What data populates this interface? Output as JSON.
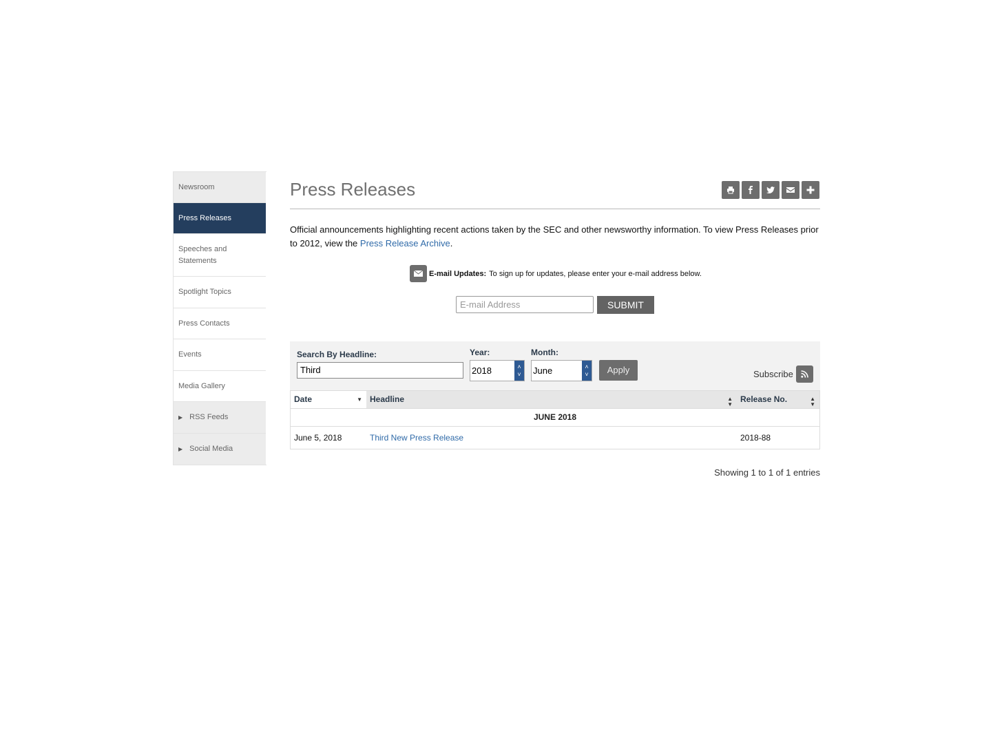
{
  "sidebar": {
    "items": [
      {
        "label": "Newsroom"
      },
      {
        "label": "Press Releases"
      },
      {
        "label": "Speeches and Statements"
      },
      {
        "label": "Spotlight Topics"
      },
      {
        "label": "Press Contacts"
      },
      {
        "label": "Events"
      },
      {
        "label": "Media Gallery"
      },
      {
        "label": "RSS Feeds"
      },
      {
        "label": "Social Media"
      }
    ]
  },
  "page": {
    "title": "Press Releases",
    "share_icons": [
      "print-icon",
      "facebook-icon",
      "twitter-icon",
      "envelope-icon",
      "plus-icon"
    ]
  },
  "intro": {
    "text_before": "Official announcements highlighting recent actions taken by the SEC and other newsworthy information.  To view Press Releases prior to 2012, view the ",
    "link": "Press Release Archive",
    "text_after": "."
  },
  "email_updates": {
    "label": "E-mail Updates:",
    "text": "To sign up for updates, please enter your e-mail address below.",
    "placeholder": "E-mail Address",
    "submit": "SUBMIT"
  },
  "filters": {
    "headline_label": "Search By Headline:",
    "headline_value": "Third",
    "year_label": "Year:",
    "year_value": "2018",
    "month_label": "Month:",
    "month_value": "June",
    "apply": "Apply",
    "subscribe": "Subscribe"
  },
  "table": {
    "columns": [
      "Date",
      "Headline",
      "Release No."
    ],
    "group": "JUNE 2018",
    "rows": [
      {
        "date": "June 5, 2018",
        "headline": "Third New Press Release",
        "release_no": "2018-88"
      }
    ],
    "info": "Showing 1 to 1 of 1 entries"
  },
  "colors": {
    "active_nav": "#243e5e",
    "link": "#2f6aa8",
    "button_gray": "#6d6d6d",
    "spinner_blue": "#2e5a93"
  }
}
